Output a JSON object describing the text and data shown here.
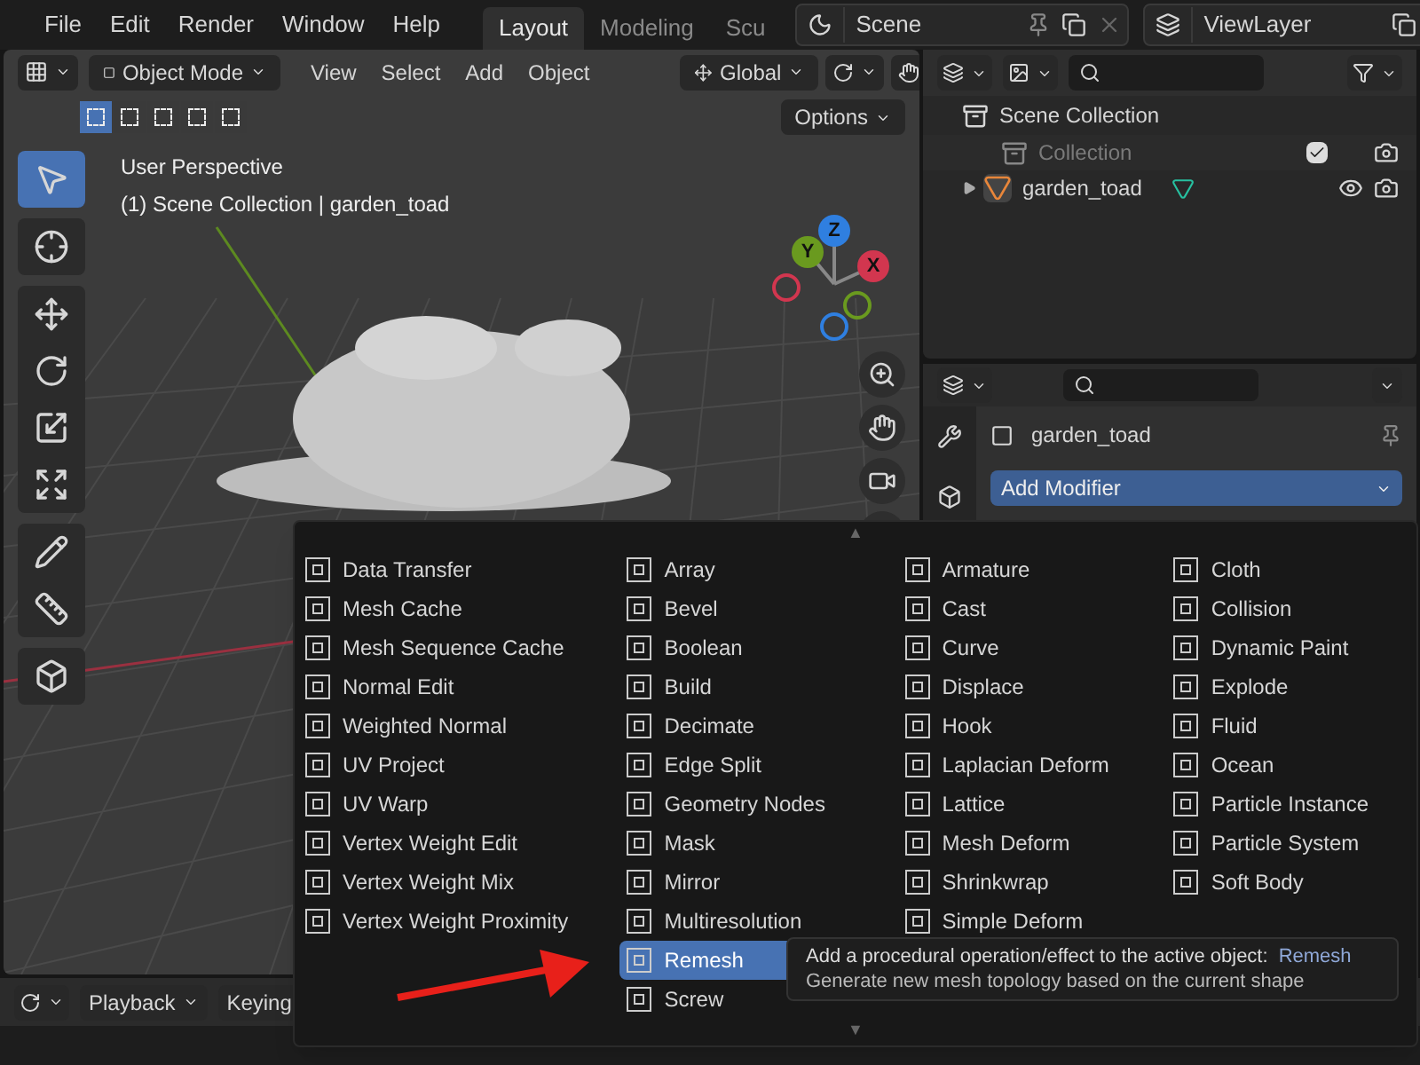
{
  "menubar": {
    "items": [
      "File",
      "Edit",
      "Render",
      "Window",
      "Help"
    ]
  },
  "workspace_tabs": [
    {
      "label": "Layout",
      "selected": true
    },
    {
      "label": "Modeling",
      "selected": false
    },
    {
      "label": "Scu",
      "selected": false
    }
  ],
  "scene_selector": {
    "value": "Scene"
  },
  "view_layer_selector": {
    "value": "ViewLayer"
  },
  "viewport": {
    "mode": "Object Mode",
    "menus": [
      "View",
      "Select",
      "Add",
      "Object"
    ],
    "orientation": "Global",
    "options_button": "Options",
    "select_modes": [
      {
        "selected": true
      },
      {
        "selected": false
      },
      {
        "selected": false
      },
      {
        "selected": false
      },
      {
        "selected": false
      }
    ],
    "info_lines": [
      "User Perspective",
      "(1) Scene Collection | garden_toad"
    ],
    "gizmo_axes": [
      {
        "label": "Z",
        "color": "#2f7fe0"
      },
      {
        "label": "Y",
        "color": "#6a9a1f"
      },
      {
        "label": "X",
        "color": "#d2364f"
      }
    ],
    "tool_groups": [
      [
        {
          "kind": "select",
          "selected": true
        }
      ],
      [
        {
          "kind": "cursor",
          "selected": false
        }
      ],
      [
        {
          "kind": "move",
          "selected": false
        },
        {
          "kind": "rotate",
          "selected": false
        },
        {
          "kind": "scale",
          "selected": false
        },
        {
          "kind": "transform",
          "selected": false
        }
      ],
      [
        {
          "kind": "annotate",
          "selected": false
        },
        {
          "kind": "measure",
          "selected": false
        }
      ],
      [
        {
          "kind": "add_cube",
          "selected": false
        }
      ]
    ]
  },
  "outliner": {
    "tree": {
      "label": "Scene Collection",
      "children": [
        {
          "kind": "collection",
          "label": "Collection",
          "checked": true
        },
        {
          "kind": "object",
          "label": "garden_toad",
          "expanded": false
        }
      ]
    }
  },
  "properties": {
    "object_name": "garden_toad",
    "add_modifier": "Add Modifier"
  },
  "timeline": {
    "menus": [
      "Playback",
      "Keying"
    ]
  },
  "modifier_menu": {
    "scroll_up": "▲",
    "scroll_down": "▼",
    "columns": [
      [
        {
          "label": "Data Transfer",
          "selected": false
        },
        {
          "label": "Mesh Cache",
          "selected": false
        },
        {
          "label": "Mesh Sequence Cache",
          "selected": false
        },
        {
          "label": "Normal Edit",
          "selected": false
        },
        {
          "label": "Weighted Normal",
          "selected": false
        },
        {
          "label": "UV Project",
          "selected": false
        },
        {
          "label": "UV Warp",
          "selected": false
        },
        {
          "label": "Vertex Weight Edit",
          "selected": false
        },
        {
          "label": "Vertex Weight Mix",
          "selected": false
        },
        {
          "label": "Vertex Weight Proximity",
          "selected": false
        }
      ],
      [
        {
          "label": "Array",
          "selected": false
        },
        {
          "label": "Bevel",
          "selected": false
        },
        {
          "label": "Boolean",
          "selected": false
        },
        {
          "label": "Build",
          "selected": false
        },
        {
          "label": "Decimate",
          "selected": false
        },
        {
          "label": "Edge Split",
          "selected": false
        },
        {
          "label": "Geometry Nodes",
          "selected": false
        },
        {
          "label": "Mask",
          "selected": false
        },
        {
          "label": "Mirror",
          "selected": false
        },
        {
          "label": "Multiresolution",
          "selected": false
        },
        {
          "label": "Remesh",
          "selected": true
        },
        {
          "label": "Screw",
          "selected": false
        }
      ],
      [
        {
          "label": "Armature",
          "selected": false
        },
        {
          "label": "Cast",
          "selected": false
        },
        {
          "label": "Curve",
          "selected": false
        },
        {
          "label": "Displace",
          "selected": false
        },
        {
          "label": "Hook",
          "selected": false
        },
        {
          "label": "Laplacian Deform",
          "selected": false
        },
        {
          "label": "Lattice",
          "selected": false
        },
        {
          "label": "Mesh Deform",
          "selected": false
        },
        {
          "label": "Shrinkwrap",
          "selected": false
        },
        {
          "label": "Simple Deform",
          "selected": false
        }
      ],
      [
        {
          "label": "Cloth",
          "selected": false
        },
        {
          "label": "Collision",
          "selected": false
        },
        {
          "label": "Dynamic Paint",
          "selected": false
        },
        {
          "label": "Explode",
          "selected": false
        },
        {
          "label": "Fluid",
          "selected": false
        },
        {
          "label": "Ocean",
          "selected": false
        },
        {
          "label": "Particle Instance",
          "selected": false
        },
        {
          "label": "Particle System",
          "selected": false
        },
        {
          "label": "Soft Body",
          "selected": false
        }
      ]
    ]
  },
  "tooltip": {
    "text": "Add a procedural operation/effect to the active object:",
    "highlight": "Remesh",
    "description": "Generate new mesh topology based on the current shape"
  }
}
